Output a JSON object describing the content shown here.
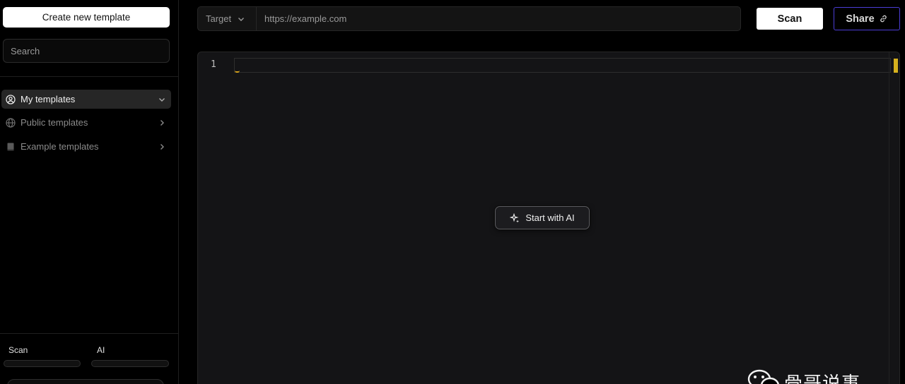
{
  "sidebar": {
    "create_label": "Create new template",
    "search_placeholder": "Search",
    "items": [
      {
        "label": "My templates",
        "icon": "user-circle-icon"
      },
      {
        "label": "Public templates",
        "icon": "globe-icon"
      },
      {
        "label": "Example templates",
        "icon": "book-icon"
      }
    ],
    "bottom": {
      "scan_label": "Scan",
      "ai_label": "AI"
    }
  },
  "topbar": {
    "target_label": "Target",
    "url_placeholder": "https://example.com",
    "scan_label": "Scan",
    "share_label": "Share"
  },
  "editor": {
    "line_number": "1",
    "ai_button_label": "Start with AI"
  },
  "watermark": {
    "text": "骨哥说事"
  },
  "colors": {
    "accent_border": "#4b3dd6",
    "cursor": "#d7a31a",
    "background": "#000000"
  }
}
